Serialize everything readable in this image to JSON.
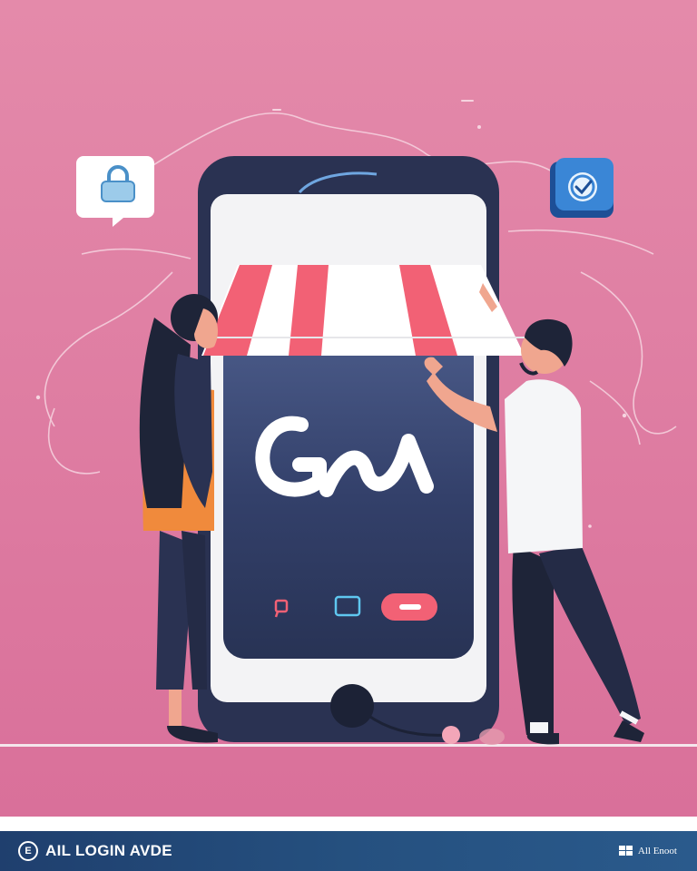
{
  "footer": {
    "logo_glyph": "E",
    "title": "AIL LOGIN AVDE",
    "brand": "All Enoot"
  },
  "scene": {
    "phone_logo": "GA",
    "icons": [
      "lock-icon",
      "check-badge-icon",
      "chat-icon",
      "square-icon",
      "pill-button-icon"
    ]
  },
  "colors": {
    "background": "#d87aa0",
    "phone_frame": "#2a3252",
    "awning_red": "#f26175",
    "footer_bar": "#25507f"
  }
}
